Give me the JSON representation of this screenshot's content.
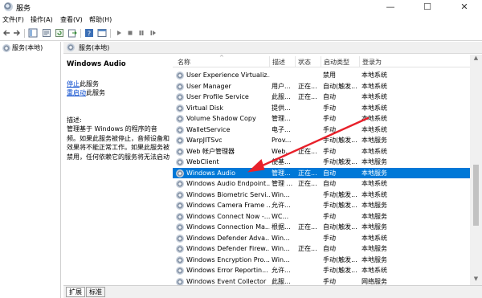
{
  "window": {
    "title": "服务",
    "controls": {
      "minimize": "—",
      "maximize": "☐",
      "close": "✕"
    }
  },
  "menu": [
    {
      "label": "文件(F)"
    },
    {
      "label": "操作(A)"
    },
    {
      "label": "查看(V)"
    },
    {
      "label": "帮助(H)"
    }
  ],
  "toolbar": {
    "buttons": [
      "back-icon",
      "forward-icon",
      "show-tree-icon",
      "properties-icon",
      "refresh-icon",
      "export-icon",
      "help-icon",
      "console-icon",
      "start-icon",
      "stop-icon",
      "pause-icon",
      "restart-icon"
    ]
  },
  "tree": {
    "item": "服务(本地)"
  },
  "header": {
    "label": "服务(本地)"
  },
  "description": {
    "title": "Windows Audio",
    "stop_link": "停止",
    "stop_suffix": "此服务",
    "restart_link": "重启动",
    "restart_suffix": "此服务",
    "desc_label": "描述:",
    "desc_text": "管理基于 Windows 的程序的音频。如果此服务被停止，音频设备和效果将不能正常工作。如果此服务被禁用，任何依赖它的服务将无法启动"
  },
  "table": {
    "columns": [
      "名称",
      "描述",
      "状态",
      "启动类型",
      "登录为"
    ],
    "rows": [
      {
        "name": "User Experience Virtualiz...",
        "desc": "",
        "status": "",
        "startup": "禁用",
        "logon": "本地系统"
      },
      {
        "name": "User Manager",
        "desc": "用户...",
        "status": "正在...",
        "startup": "自动(触发...",
        "logon": "本地系统"
      },
      {
        "name": "User Profile Service",
        "desc": "此服...",
        "status": "正在...",
        "startup": "自动",
        "logon": "本地系统"
      },
      {
        "name": "Virtual Disk",
        "desc": "提供...",
        "status": "",
        "startup": "手动",
        "logon": "本地系统"
      },
      {
        "name": "Volume Shadow Copy",
        "desc": "管理...",
        "status": "",
        "startup": "手动",
        "logon": "本地系统"
      },
      {
        "name": "WalletService",
        "desc": "电子...",
        "status": "",
        "startup": "手动",
        "logon": "本地系统"
      },
      {
        "name": "WarpJITSvc",
        "desc": "Prov...",
        "status": "",
        "startup": "手动(触发...",
        "logon": "本地服务"
      },
      {
        "name": "Web 帐户管理器",
        "desc": "Web...",
        "status": "正在...",
        "startup": "手动",
        "logon": "本地系统"
      },
      {
        "name": "WebClient",
        "desc": "使基...",
        "status": "",
        "startup": "手动(触发...",
        "logon": "本地服务"
      },
      {
        "name": "Windows Audio",
        "desc": "管理...",
        "status": "正在...",
        "startup": "自动",
        "logon": "本地服务",
        "selected": true
      },
      {
        "name": "Windows Audio Endpoint...",
        "desc": "管理 ...",
        "status": "正在...",
        "startup": "自动",
        "logon": "本地系统"
      },
      {
        "name": "Windows Biometric Servi...",
        "desc": "Win...",
        "status": "",
        "startup": "手动(触发...",
        "logon": "本地系统"
      },
      {
        "name": "Windows Camera Frame ...",
        "desc": "允许...",
        "status": "",
        "startup": "手动(触发...",
        "logon": "本地服务"
      },
      {
        "name": "Windows Connect Now -...",
        "desc": "WC...",
        "status": "",
        "startup": "手动",
        "logon": "本地服务"
      },
      {
        "name": "Windows Connection Ma...",
        "desc": "根据...",
        "status": "正在...",
        "startup": "自动(触发...",
        "logon": "本地服务"
      },
      {
        "name": "Windows Defender Adva...",
        "desc": "Win...",
        "status": "",
        "startup": "手动",
        "logon": "本地系统"
      },
      {
        "name": "Windows Defender Firew...",
        "desc": "Win...",
        "status": "正在...",
        "startup": "自动",
        "logon": "本地服务"
      },
      {
        "name": "Windows Encryption Pro...",
        "desc": "Win...",
        "status": "",
        "startup": "手动(触发...",
        "logon": "本地服务"
      },
      {
        "name": "Windows Error Reportin...",
        "desc": "允许...",
        "status": "",
        "startup": "手动(触发...",
        "logon": "本地系统"
      },
      {
        "name": "Windows Event Collector",
        "desc": "此服...",
        "status": "",
        "startup": "手动",
        "logon": "网络服务"
      }
    ]
  },
  "tabs": [
    {
      "label": "扩展"
    },
    {
      "label": "标准"
    }
  ],
  "colors": {
    "selection": "#0078d7",
    "annotation_arrow": "#e8202a",
    "link": "#0044cc"
  }
}
